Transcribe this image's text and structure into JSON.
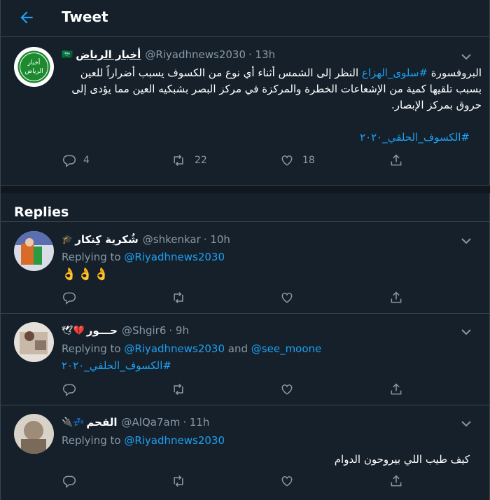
{
  "header": {
    "title": "Tweet",
    "back_icon": "arrow-left-icon"
  },
  "tweet": {
    "name": "أخبار الرياض",
    "flag": "🇸🇦",
    "handle": "@Riyadhnews2030",
    "time": "· 13h",
    "avatar_lines": [
      "أخبار",
      "الرياض"
    ],
    "text": {
      "prefix": "البروفسورة ",
      "hashtag1": "#سلوى_الهزاع",
      "body": " النظر إلى الشمس أثناء أي نوع من الكسوف يسبب أضراراً للعين بسبب تلقيها كمية من الإشعاعات الخطرة والمركزة في مركز البصر بشبكيه العين مما يؤدى إلى حروق بمركز الإبصار.",
      "hashtag2": "#الكسوف_الحلقي_٢٠٢٠"
    },
    "stats": {
      "replies": "4",
      "retweets": "22",
      "likes": "18"
    }
  },
  "replies_header": "Replies",
  "replies": [
    {
      "name": "شُكرية كِنكار",
      "emoji": "🎓",
      "handle": "@shkenkar",
      "time": "· 10h",
      "replying_prefix": "Replying to ",
      "replying_to": "@Riyadhnews2030",
      "text": "👌👌👌"
    },
    {
      "name": "حـــور",
      "emoji": "🕊💔",
      "handle": "@Shgir6",
      "time": "· 9h",
      "replying_prefix": "Replying to ",
      "replying_to": "@Riyadhnews2030",
      "replying_and": " and ",
      "replying_to2": "@see_moone",
      "hashtag": "#الكسوف_الحلقي_٢٠٢٠"
    },
    {
      "name": "القحم",
      "emoji": "🔌💤",
      "handle": "@AlQa7am",
      "time": "· 11h",
      "replying_prefix": "Replying to ",
      "replying_to": "@Riyadhnews2030",
      "text": "كيف طيب اللي بيروحون الدوام"
    }
  ],
  "colors": {
    "background": "#15202b",
    "border": "#38444d",
    "accent": "#1da1f2",
    "muted": "#8899a6",
    "avatar_green": "#1e8a2f"
  },
  "icons": [
    "reply-icon",
    "retweet-icon",
    "like-icon",
    "share-icon",
    "chevron-down-icon"
  ]
}
